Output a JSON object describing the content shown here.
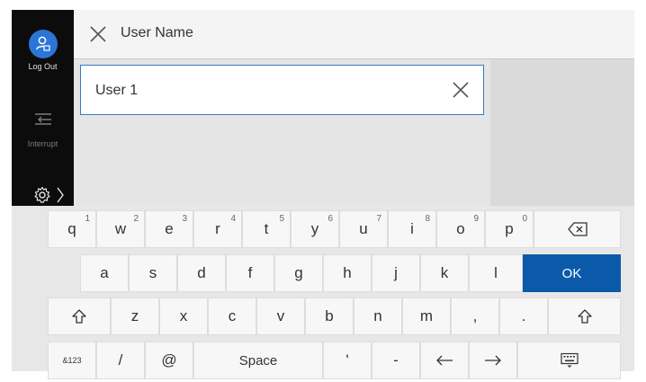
{
  "sidebar": {
    "logout_label": "Log Out",
    "interrupt_label": "Interrupt",
    "icons": {
      "logout": "user-logout-icon",
      "interrupt": "interrupt-icon",
      "settings": "gear-icon",
      "expand": "chevron-right-icon"
    }
  },
  "header": {
    "title": "User Name",
    "close_icon": "close-icon"
  },
  "input": {
    "value": "User 1",
    "clear_icon": "close-icon"
  },
  "keyboard": {
    "row1": [
      {
        "label": "q",
        "sup": "1"
      },
      {
        "label": "w",
        "sup": "2"
      },
      {
        "label": "e",
        "sup": "3"
      },
      {
        "label": "r",
        "sup": "4"
      },
      {
        "label": "t",
        "sup": "5"
      },
      {
        "label": "y",
        "sup": "6"
      },
      {
        "label": "u",
        "sup": "7"
      },
      {
        "label": "i",
        "sup": "8"
      },
      {
        "label": "o",
        "sup": "9"
      },
      {
        "label": "p",
        "sup": "0"
      },
      {
        "label": "⌫",
        "icon": "backspace-icon"
      }
    ],
    "row2": [
      {
        "label": "a"
      },
      {
        "label": "s"
      },
      {
        "label": "d"
      },
      {
        "label": "f"
      },
      {
        "label": "g"
      },
      {
        "label": "h"
      },
      {
        "label": "j"
      },
      {
        "label": "k"
      },
      {
        "label": "l"
      },
      {
        "label": "OK"
      }
    ],
    "row3": [
      {
        "label": "⇧",
        "icon": "shift-icon"
      },
      {
        "label": "z"
      },
      {
        "label": "x"
      },
      {
        "label": "c"
      },
      {
        "label": "v"
      },
      {
        "label": "b"
      },
      {
        "label": "n"
      },
      {
        "label": "m"
      },
      {
        "label": ","
      },
      {
        "label": "."
      },
      {
        "label": "⇧",
        "icon": "shift-icon"
      }
    ],
    "row4": [
      {
        "label": "&123"
      },
      {
        "label": "/"
      },
      {
        "label": "@"
      },
      {
        "label": "Space"
      },
      {
        "label": "'"
      },
      {
        "label": "-"
      },
      {
        "label": "←",
        "icon": "arrow-left-icon"
      },
      {
        "label": "→",
        "icon": "arrow-right-icon"
      },
      {
        "label": "⌨",
        "icon": "keyboard-hide-icon"
      }
    ]
  },
  "colors": {
    "accent": "#0b5aa9",
    "sidebar_bg": "#0c0c0c",
    "avatar": "#2b75d6",
    "input_border": "#3a78c9"
  }
}
